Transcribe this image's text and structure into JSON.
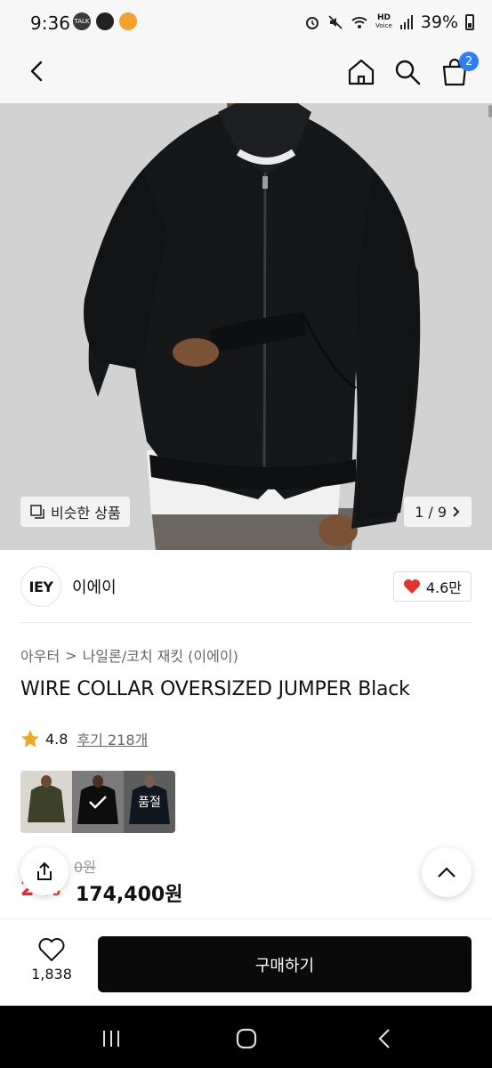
{
  "status_bar": {
    "time": "9:36",
    "talk_label": "TALK",
    "hd_label": "HD",
    "voice_label": "Voice",
    "battery": "39%"
  },
  "header": {
    "cart_count": "2"
  },
  "hero": {
    "similar_label": "비슷한 상품",
    "pager": "1 / 9"
  },
  "brand": {
    "logo_text": "IEY",
    "name": "이에이",
    "likes": "4.6만"
  },
  "breadcrumb": {
    "level1": "아우터",
    "separator": ">",
    "level2": "나일론/코치 재킷 (이에이)"
  },
  "product": {
    "title": "WIRE COLLAR OVERSIZED JUMPER Black",
    "rating": "4.8",
    "reviews": "후기 218개",
    "soldout_label": "품절",
    "original_price": "0원",
    "discount": "2 %",
    "sale_price": "174,400원"
  },
  "bottom": {
    "wish_count": "1,838",
    "buy_label": "구매하기"
  },
  "colors": {
    "accent_blue": "#2d7ff9",
    "heart_red": "#e5322d",
    "star": "#f5a623"
  }
}
